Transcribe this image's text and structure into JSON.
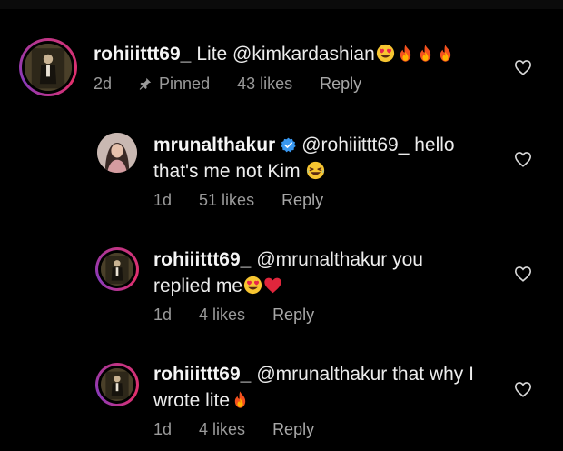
{
  "comments": [
    {
      "username": "rohiiittt69_",
      "text": "Lite @kimkardashian",
      "emojis": [
        "heart-eyes-emoji",
        "fire-emoji",
        "fire-emoji",
        "fire-emoji"
      ],
      "time": "2d",
      "pinned_label": "Pinned",
      "likes": "43 likes",
      "reply": "Reply"
    },
    {
      "username": "mrunalthakur",
      "verified": true,
      "text_line1": "@rohiiittt69_ hello",
      "text_line2": "that's me not Kim",
      "emojis": [
        "laughing-emoji"
      ],
      "time": "1d",
      "likes": "51 likes",
      "reply": "Reply"
    },
    {
      "username": "rohiiittt69_",
      "text_line1": "@mrunalthakur you",
      "text_line2": "replied me",
      "emojis": [
        "heart-eyes-emoji",
        "red-heart-emoji"
      ],
      "time": "1d",
      "likes": "4 likes",
      "reply": "Reply"
    },
    {
      "username": "rohiiittt69_",
      "text_line1": "@mrunalthakur  that why I",
      "text_line2": "wrote lite",
      "emojis": [
        "fire-emoji"
      ],
      "time": "1d",
      "likes": "4 likes",
      "reply": "Reply"
    }
  ],
  "colors": {
    "background": "#000000",
    "text": "#ededed",
    "meta": "#9a9a9a",
    "verified": "#3897f0",
    "story_ring": "#c13584"
  }
}
